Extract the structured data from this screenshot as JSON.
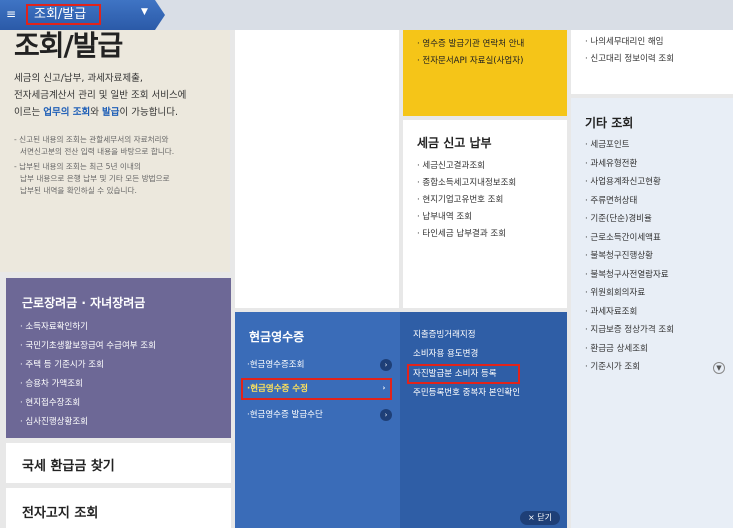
{
  "topnav": {
    "title": "조회/발급"
  },
  "intro": {
    "title": "조회/발급",
    "desc_line1": "세금의 신고/납부, 과세자료제출,",
    "desc_line2": "전자세금계산서 관리 및 일반 조회 서비스에",
    "desc_line3_pre": "이르는 ",
    "desc_line3_hl1": "업무의 조회",
    "desc_line3_mid": "와 ",
    "desc_line3_hl2": "발급",
    "desc_line3_post": "이 가능합니다.",
    "note1_line1": "- 신고된 내용의 조회는 관할세무서의 자료처리와",
    "note1_line2": "서면신고분의 전산 입력 내용을 바탕으로 합니다.",
    "note2_line1": "- 납부된 내용의 조회는 최근 5년 이내의",
    "note2_line2": "납부 내용으로 은행 납부 및 기타 모든 방법으로",
    "note2_line3": "납부된 내역을 확인하실 수 있습니다."
  },
  "earned_income": {
    "title": "근로장려금 · 자녀장려금",
    "items": [
      "소득자료확인하기",
      "국민기초생활보장급여 수급여부 조회",
      "주택 등 기준시가 조회",
      "승용차 가액조회",
      "현지접수장조회",
      "심사진행상황조회"
    ]
  },
  "refund": {
    "title": "국세 환급금 찾기"
  },
  "notice": {
    "title": "전자고지 조회"
  },
  "yellow": {
    "items": [
      "영수증 발급기관 연락처 안내",
      "전자문서API 자료실(사업자)"
    ]
  },
  "tax_report": {
    "title": "세금 신고 납부",
    "items": [
      "세금신고결과조회",
      "종합소득세고지내정보조회",
      "현지기업고유번호 조회",
      "납부내역 조회",
      "타인세금 납부결과 조회"
    ]
  },
  "right_top": {
    "items": [
      "나의세무대리인 해임",
      "신고대리 정보이력 조회"
    ]
  },
  "etc": {
    "title": "기타 조회",
    "items": [
      "세금포인트",
      "과세유형전환",
      "사업용계좌신고현황",
      "주류면허상태",
      "기준(단순)경비율",
      "근로소득간이세액표",
      "불복청구진행상황",
      "불복청구사전열람자료",
      "위원회회의자료",
      "과세자료조회",
      "지급보증 정상가격 조회",
      "환급금 상세조회",
      "기준시가 조회"
    ]
  },
  "cash_receipt": {
    "title": "현금영수증",
    "left_items": [
      "·현금영수증조회",
      "·현금영수증 수정",
      "·현금영수증 발급수단"
    ],
    "right_items": [
      "지출증빙거래지정",
      "소비자용 용도변경",
      "자진발급분 소비자 등록",
      "주민등록번호 중복자 본인확인"
    ],
    "close_label": "× 닫기"
  }
}
